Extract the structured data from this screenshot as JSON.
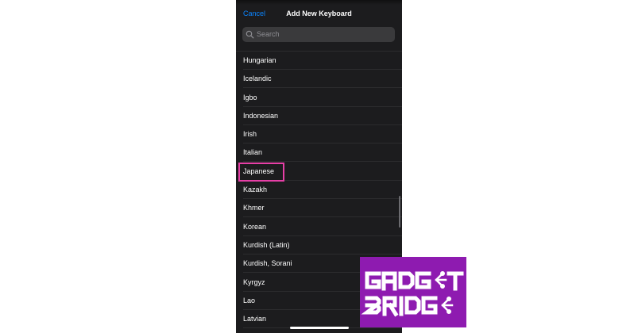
{
  "header": {
    "cancel_label": "Cancel",
    "title": "Add New Keyboard"
  },
  "search": {
    "placeholder": "Search"
  },
  "languages": [
    "Hungarian",
    "Icelandic",
    "Igbo",
    "Indonesian",
    "Irish",
    "Italian",
    "Japanese",
    "Kazakh",
    "Khmer",
    "Korean",
    "Kurdish (Latin)",
    "Kurdish, Sorani",
    "Kyrgyz",
    "Lao",
    "Latvian"
  ],
  "highlighted_language": "Japanese",
  "watermark": {
    "line1": "GADGET",
    "line2": "BRIDGE"
  },
  "colors": {
    "accent": "#0a84ff",
    "highlight_border": "#e63fa6",
    "logo_background": "#8e1bb0"
  },
  "icons": [
    "search-icon"
  ]
}
